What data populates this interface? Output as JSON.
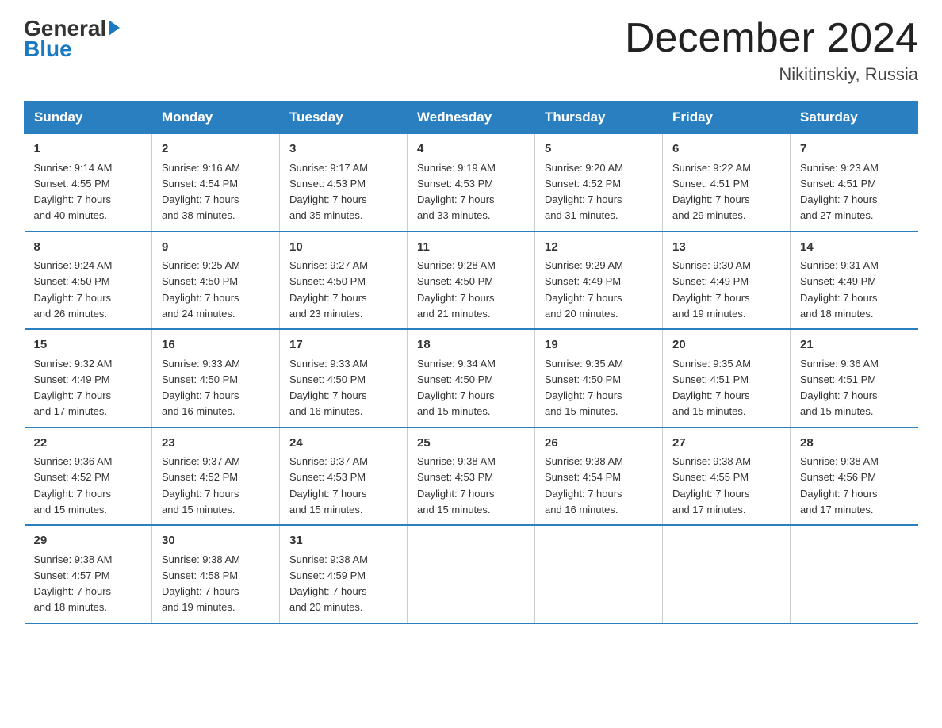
{
  "header": {
    "logo_general": "General",
    "logo_blue": "Blue",
    "month_title": "December 2024",
    "location": "Nikitinskiy, Russia"
  },
  "days_of_week": [
    "Sunday",
    "Monday",
    "Tuesday",
    "Wednesday",
    "Thursday",
    "Friday",
    "Saturday"
  ],
  "weeks": [
    [
      {
        "day": "1",
        "sunrise": "9:14 AM",
        "sunset": "4:55 PM",
        "daylight": "7 hours and 40 minutes."
      },
      {
        "day": "2",
        "sunrise": "9:16 AM",
        "sunset": "4:54 PM",
        "daylight": "7 hours and 38 minutes."
      },
      {
        "day": "3",
        "sunrise": "9:17 AM",
        "sunset": "4:53 PM",
        "daylight": "7 hours and 35 minutes."
      },
      {
        "day": "4",
        "sunrise": "9:19 AM",
        "sunset": "4:53 PM",
        "daylight": "7 hours and 33 minutes."
      },
      {
        "day": "5",
        "sunrise": "9:20 AM",
        "sunset": "4:52 PM",
        "daylight": "7 hours and 31 minutes."
      },
      {
        "day": "6",
        "sunrise": "9:22 AM",
        "sunset": "4:51 PM",
        "daylight": "7 hours and 29 minutes."
      },
      {
        "day": "7",
        "sunrise": "9:23 AM",
        "sunset": "4:51 PM",
        "daylight": "7 hours and 27 minutes."
      }
    ],
    [
      {
        "day": "8",
        "sunrise": "9:24 AM",
        "sunset": "4:50 PM",
        "daylight": "7 hours and 26 minutes."
      },
      {
        "day": "9",
        "sunrise": "9:25 AM",
        "sunset": "4:50 PM",
        "daylight": "7 hours and 24 minutes."
      },
      {
        "day": "10",
        "sunrise": "9:27 AM",
        "sunset": "4:50 PM",
        "daylight": "7 hours and 23 minutes."
      },
      {
        "day": "11",
        "sunrise": "9:28 AM",
        "sunset": "4:50 PM",
        "daylight": "7 hours and 21 minutes."
      },
      {
        "day": "12",
        "sunrise": "9:29 AM",
        "sunset": "4:49 PM",
        "daylight": "7 hours and 20 minutes."
      },
      {
        "day": "13",
        "sunrise": "9:30 AM",
        "sunset": "4:49 PM",
        "daylight": "7 hours and 19 minutes."
      },
      {
        "day": "14",
        "sunrise": "9:31 AM",
        "sunset": "4:49 PM",
        "daylight": "7 hours and 18 minutes."
      }
    ],
    [
      {
        "day": "15",
        "sunrise": "9:32 AM",
        "sunset": "4:49 PM",
        "daylight": "7 hours and 17 minutes."
      },
      {
        "day": "16",
        "sunrise": "9:33 AM",
        "sunset": "4:50 PM",
        "daylight": "7 hours and 16 minutes."
      },
      {
        "day": "17",
        "sunrise": "9:33 AM",
        "sunset": "4:50 PM",
        "daylight": "7 hours and 16 minutes."
      },
      {
        "day": "18",
        "sunrise": "9:34 AM",
        "sunset": "4:50 PM",
        "daylight": "7 hours and 15 minutes."
      },
      {
        "day": "19",
        "sunrise": "9:35 AM",
        "sunset": "4:50 PM",
        "daylight": "7 hours and 15 minutes."
      },
      {
        "day": "20",
        "sunrise": "9:35 AM",
        "sunset": "4:51 PM",
        "daylight": "7 hours and 15 minutes."
      },
      {
        "day": "21",
        "sunrise": "9:36 AM",
        "sunset": "4:51 PM",
        "daylight": "7 hours and 15 minutes."
      }
    ],
    [
      {
        "day": "22",
        "sunrise": "9:36 AM",
        "sunset": "4:52 PM",
        "daylight": "7 hours and 15 minutes."
      },
      {
        "day": "23",
        "sunrise": "9:37 AM",
        "sunset": "4:52 PM",
        "daylight": "7 hours and 15 minutes."
      },
      {
        "day": "24",
        "sunrise": "9:37 AM",
        "sunset": "4:53 PM",
        "daylight": "7 hours and 15 minutes."
      },
      {
        "day": "25",
        "sunrise": "9:38 AM",
        "sunset": "4:53 PM",
        "daylight": "7 hours and 15 minutes."
      },
      {
        "day": "26",
        "sunrise": "9:38 AM",
        "sunset": "4:54 PM",
        "daylight": "7 hours and 16 minutes."
      },
      {
        "day": "27",
        "sunrise": "9:38 AM",
        "sunset": "4:55 PM",
        "daylight": "7 hours and 17 minutes."
      },
      {
        "day": "28",
        "sunrise": "9:38 AM",
        "sunset": "4:56 PM",
        "daylight": "7 hours and 17 minutes."
      }
    ],
    [
      {
        "day": "29",
        "sunrise": "9:38 AM",
        "sunset": "4:57 PM",
        "daylight": "7 hours and 18 minutes."
      },
      {
        "day": "30",
        "sunrise": "9:38 AM",
        "sunset": "4:58 PM",
        "daylight": "7 hours and 19 minutes."
      },
      {
        "day": "31",
        "sunrise": "9:38 AM",
        "sunset": "4:59 PM",
        "daylight": "7 hours and 20 minutes."
      },
      {
        "day": "",
        "sunrise": "",
        "sunset": "",
        "daylight": ""
      },
      {
        "day": "",
        "sunrise": "",
        "sunset": "",
        "daylight": ""
      },
      {
        "day": "",
        "sunrise": "",
        "sunset": "",
        "daylight": ""
      },
      {
        "day": "",
        "sunrise": "",
        "sunset": "",
        "daylight": ""
      }
    ]
  ]
}
